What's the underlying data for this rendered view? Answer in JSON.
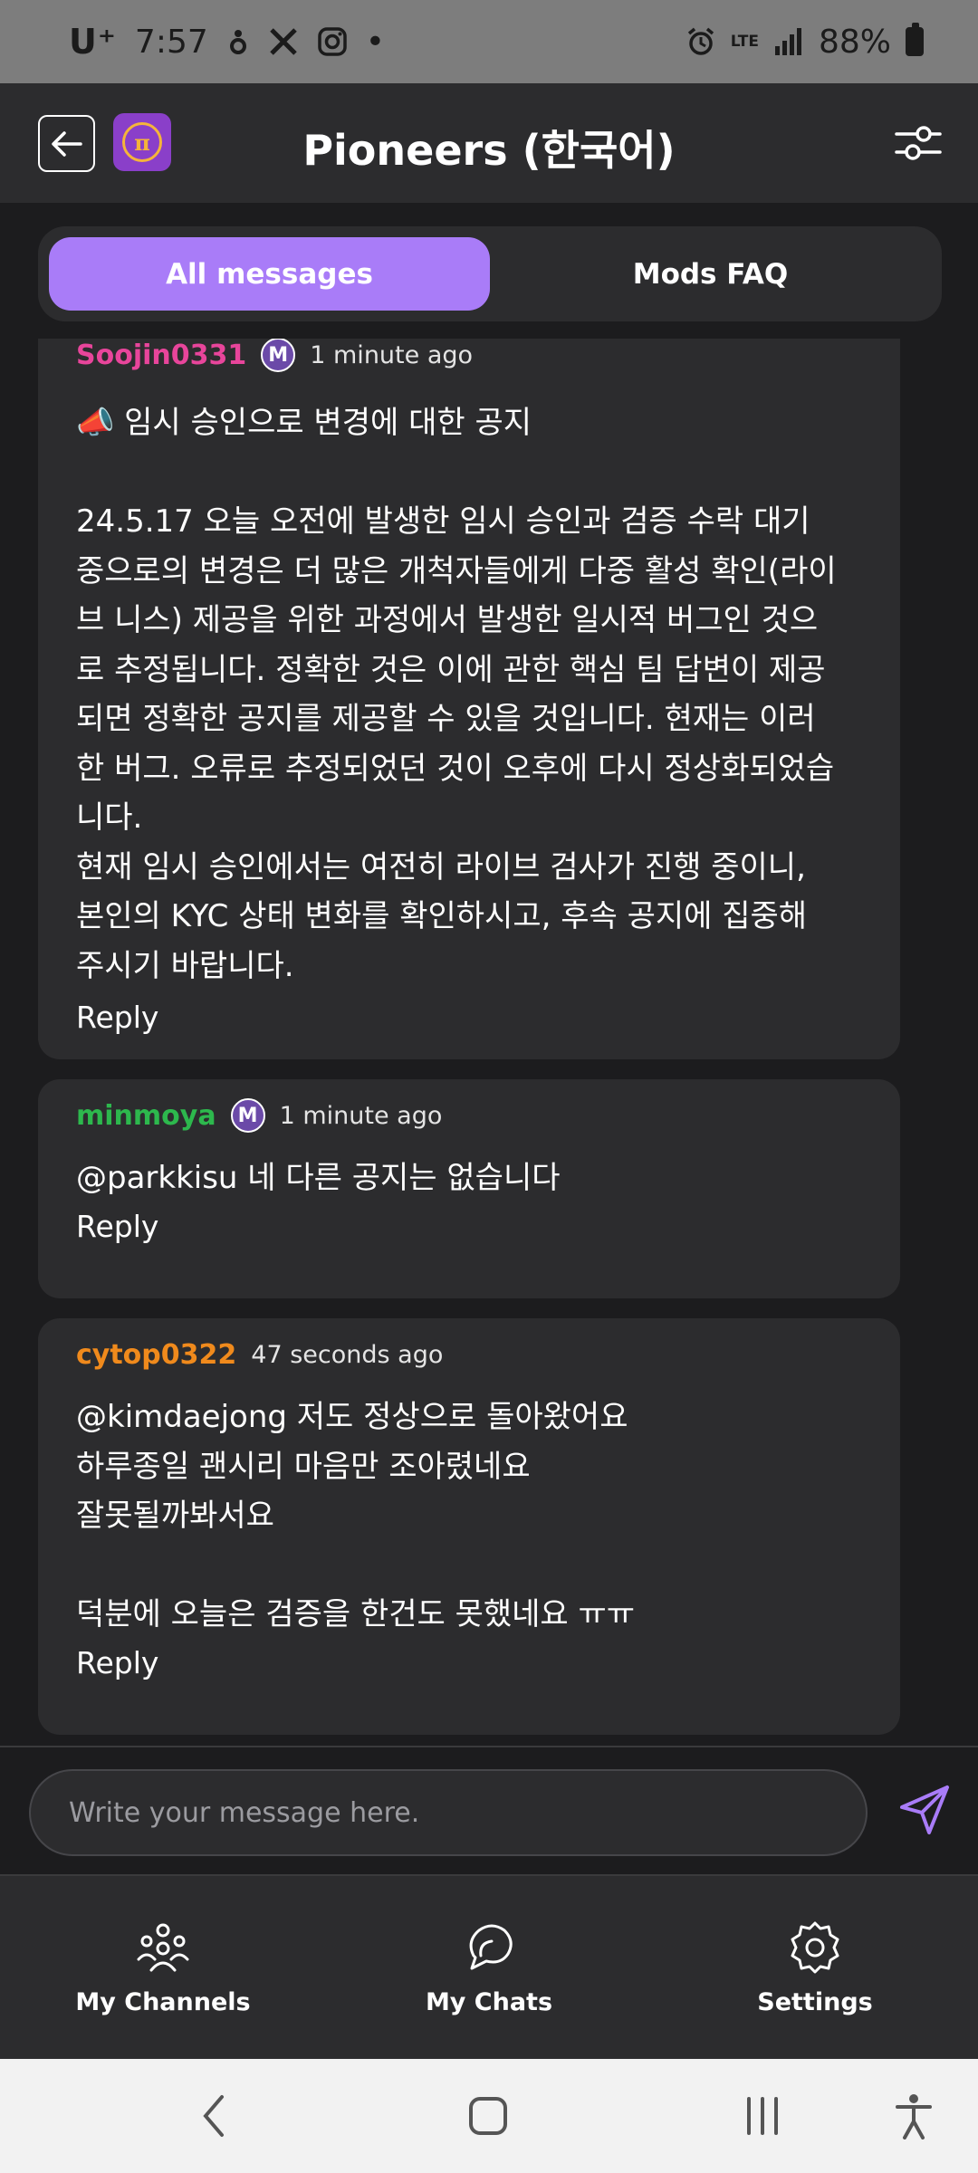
{
  "status_bar": {
    "carrier": "U⁺",
    "time": "7:57",
    "dot": "•",
    "network": "LTE",
    "battery": "88%"
  },
  "header": {
    "title": "Pioneers (한국어)",
    "back_icon": "back-arrow-icon",
    "logo_symbol": "π",
    "filter_icon": "sliders-icon"
  },
  "tabs": [
    {
      "label": "All messages",
      "active": true
    },
    {
      "label": "Mods FAQ",
      "active": false
    }
  ],
  "messages": [
    {
      "username": "Soojin0331",
      "username_color": "#e8459b",
      "badge": "M",
      "timestamp": "1 minute ago",
      "text": "📣 임시 승인으로 변경에 대한 공지\n\n24.5.17 오늘 오전에 발생한 임시 승인과 검증 수락 대기\n중으로의 변경은 더 많은 개척자들에게 다중 활성 확인(라이\n브 니스) 제공을 위한 과정에서 발생한 일시적 버그인 것으\n로 추정됩니다. 정확한 것은 이에 관한 핵심 팀 답변이 제공\n되면 정확한 공지를 제공할 수 있을 것입니다. 현재는 이러\n한 버그. 오류로 추정되었던 것이 오후에 다시 정상화되었습\n니다.\n현재 임시 승인에서는 여전히 라이브 검사가 진행 중이니,\n본인의 KYC 상태 변화를 확인하시고, 후속 공지에 집중해\n주시기 바랍니다.",
      "reply_label": "Reply"
    },
    {
      "username": "minmoya",
      "username_color": "#2db84d",
      "badge": "M",
      "timestamp": "1 minute ago",
      "text": "@parkkisu 네 다른 공지는 없습니다",
      "reply_label": "Reply"
    },
    {
      "username": "cytop0322",
      "username_color": "#f08a1c",
      "badge": "",
      "timestamp": "47 seconds ago",
      "text": "@kimdaejong 저도 정상으로 돌아왔어요\n하루종일 괜시리 마음만 조아렸네요\n잘못될까봐서요\n\n덕분에 오늘은 검증을 한건도 못했네요 ㅠㅠ",
      "reply_label": "Reply"
    }
  ],
  "composer": {
    "placeholder": "Write your message here.",
    "send_icon": "send-icon"
  },
  "bottom_nav": [
    {
      "label": "My Channels",
      "icon": "channels-icon"
    },
    {
      "label": "My Chats",
      "icon": "chats-icon"
    },
    {
      "label": "Settings",
      "icon": "gear-icon"
    }
  ],
  "colors": {
    "accent": "#a97cf8",
    "background": "#1c1c1e",
    "card": "#2c2c2e"
  }
}
